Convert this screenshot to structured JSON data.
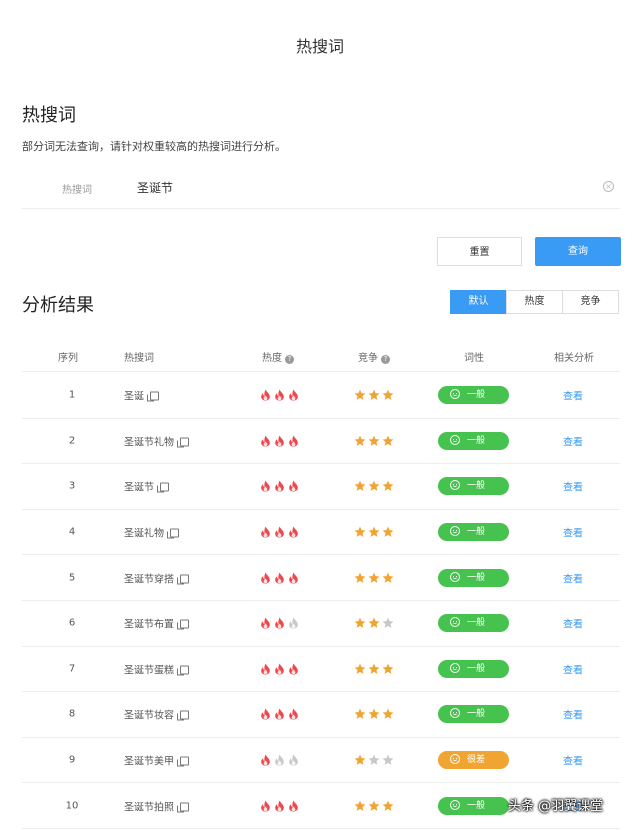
{
  "page_title": "热搜词",
  "section1": {
    "title": "热搜词",
    "description": "部分词无法查询，请针对权重较高的热搜词进行分析。"
  },
  "search": {
    "label": "热搜词",
    "value": "圣诞节",
    "clear_icon": "clear-circle-icon"
  },
  "buttons": {
    "reset": "重置",
    "query": "查询"
  },
  "section2": {
    "title": "分析结果"
  },
  "sort_tabs": [
    {
      "label": "默认",
      "active": true
    },
    {
      "label": "热度",
      "active": false
    },
    {
      "label": "竞争",
      "active": false
    }
  ],
  "table": {
    "headers": {
      "index": "序列",
      "word": "热搜词",
      "heat": "热度",
      "competition": "竞争",
      "tone": "词性",
      "analysis": "相关分析"
    },
    "rows": [
      {
        "index": "1",
        "word": "圣诞",
        "heat": 3,
        "competition": 3,
        "tone": "一般",
        "tone_type": "good",
        "link": "查看"
      },
      {
        "index": "2",
        "word": "圣诞节礼物",
        "heat": 3,
        "competition": 3,
        "tone": "一般",
        "tone_type": "good",
        "link": "查看"
      },
      {
        "index": "3",
        "word": "圣诞节",
        "heat": 3,
        "competition": 3,
        "tone": "一般",
        "tone_type": "good",
        "link": "查看"
      },
      {
        "index": "4",
        "word": "圣诞礼物",
        "heat": 3,
        "competition": 3,
        "tone": "一般",
        "tone_type": "good",
        "link": "查看"
      },
      {
        "index": "5",
        "word": "圣诞节穿搭",
        "heat": 3,
        "competition": 3,
        "tone": "一般",
        "tone_type": "good",
        "link": "查看"
      },
      {
        "index": "6",
        "word": "圣诞节布置",
        "heat": 2,
        "competition": 2,
        "tone": "一般",
        "tone_type": "good",
        "link": "查看"
      },
      {
        "index": "7",
        "word": "圣诞节蛋糕",
        "heat": 3,
        "competition": 3,
        "tone": "一般",
        "tone_type": "good",
        "link": "查看"
      },
      {
        "index": "8",
        "word": "圣诞节妆容",
        "heat": 3,
        "competition": 3,
        "tone": "一般",
        "tone_type": "good",
        "link": "查看"
      },
      {
        "index": "9",
        "word": "圣诞节美甲",
        "heat": 1,
        "competition": 1,
        "tone": "很差",
        "tone_type": "bad",
        "link": "查看"
      },
      {
        "index": "10",
        "word": "圣诞节拍照",
        "heat": 3,
        "competition": 3,
        "tone": "一般",
        "tone_type": "good",
        "link": "查看"
      }
    ]
  },
  "colors": {
    "accent": "#3a9bf5",
    "flame_active": "#f0474d",
    "flame_inactive": "#c8c8c8",
    "star_active": "#f0a533",
    "star_inactive": "#c8c8c8",
    "tag_good": "#46c24e",
    "tag_bad": "#f0a533"
  },
  "watermark": "头条 @羽翼课堂"
}
